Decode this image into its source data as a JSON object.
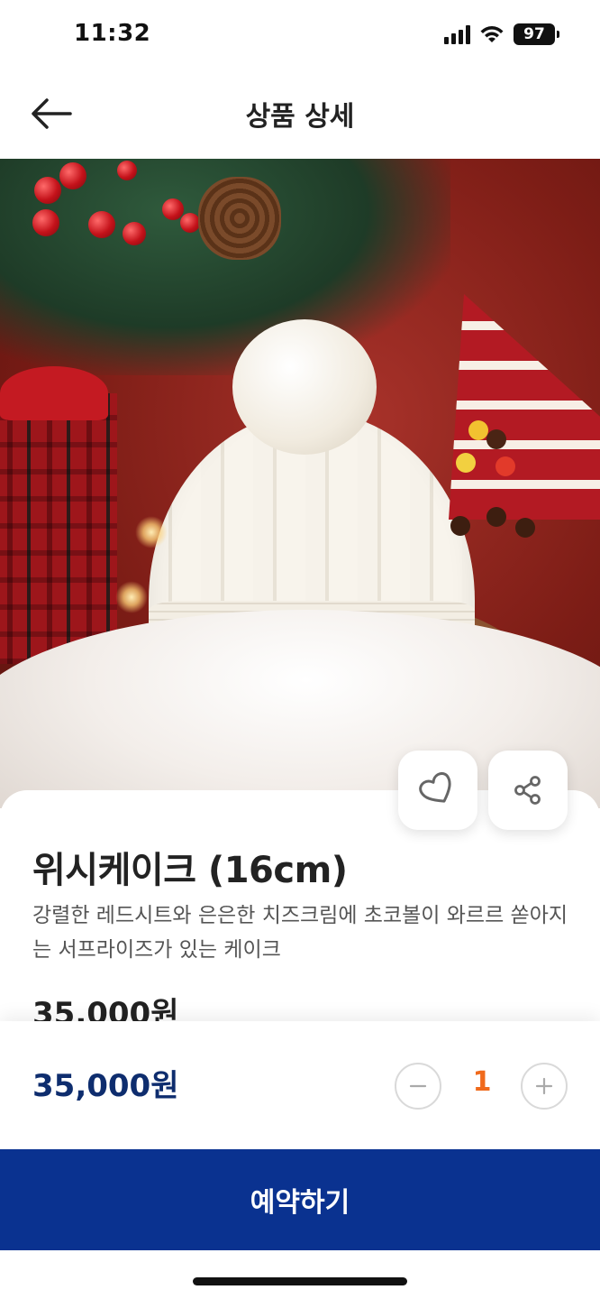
{
  "status_bar": {
    "time": "11:32",
    "battery": "97",
    "icons": [
      "signal-icon",
      "wifi-icon",
      "battery-icon"
    ]
  },
  "header": {
    "title": "상품 상세",
    "back_icon": "arrow-left-icon"
  },
  "hero": {
    "actions": [
      {
        "name": "like",
        "icon": "heart-outline-icon"
      },
      {
        "name": "share",
        "icon": "share-icon"
      }
    ]
  },
  "product": {
    "name": "위시케이크 (16cm)",
    "description": "강렬한 레드시트와 은은한 치즈크림에 초코볼이 와르르 쏟아지는 서프라이즈가 있는 케이크",
    "price": "35,000원"
  },
  "order": {
    "total_price": "35,000원",
    "quantity": "1",
    "minus_icon": "minus-icon",
    "plus_icon": "plus-icon",
    "reserve_label": "예약하기"
  },
  "colors": {
    "accent": "#0a3290",
    "price_total": "#0e2d6e",
    "quantity": "#f06a1c"
  }
}
